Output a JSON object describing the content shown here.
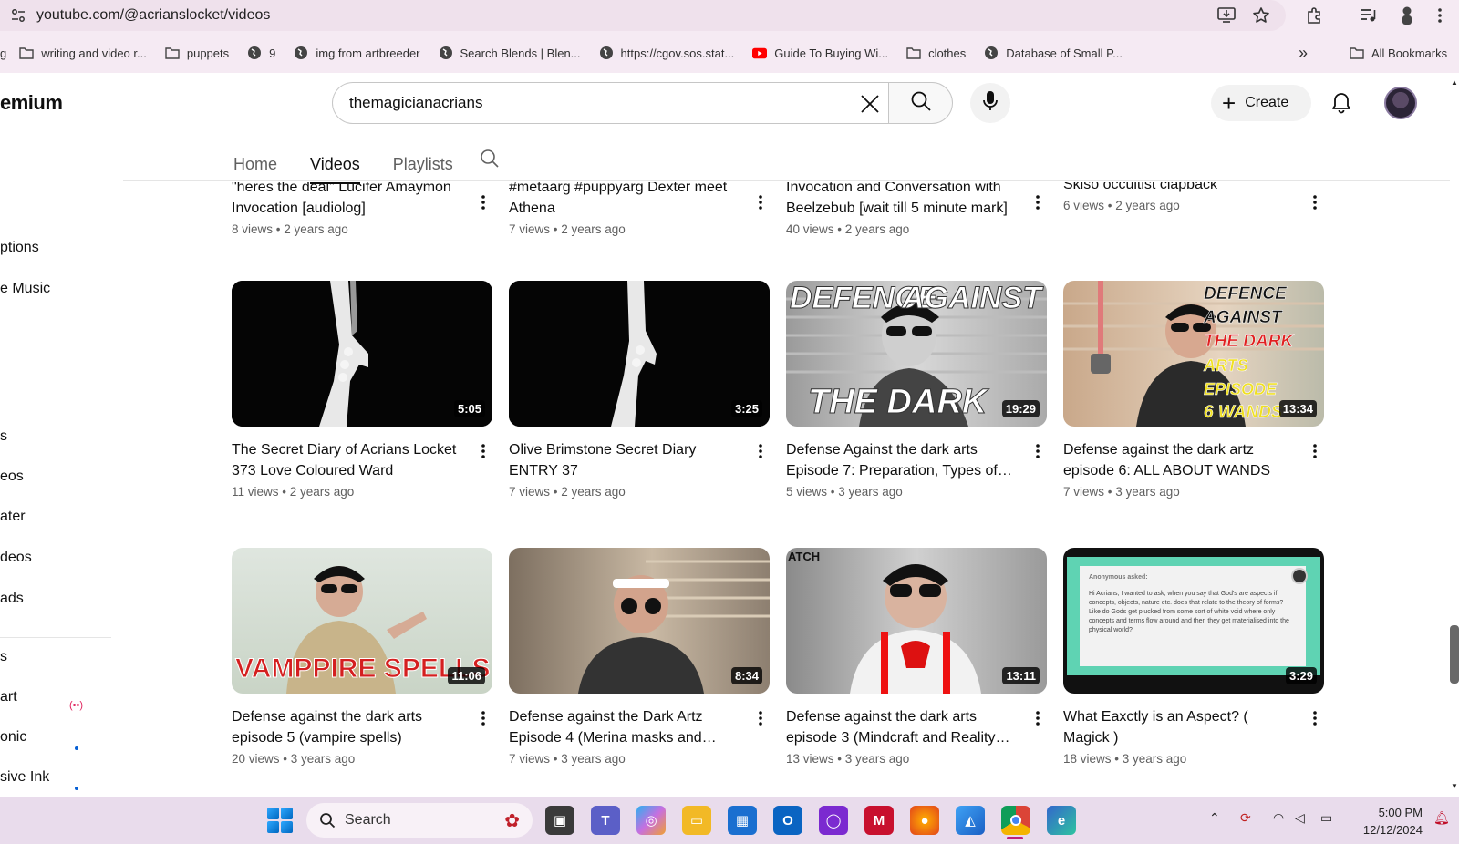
{
  "browser": {
    "url": "youtube.com/@acrianslocket/videos",
    "bookmarks": [
      "writing and video r...",
      "puppets",
      "9",
      "img from artbreeder",
      "Search Blends | Blen...",
      "https://cgov.sos.stat...",
      "Guide To Buying Wi...",
      "clothes",
      "Database of Small P..."
    ],
    "bookmark_first_partial": "g",
    "overflow_label": "»",
    "all_bookmarks": "All Bookmarks"
  },
  "header": {
    "logo_partial": "emium",
    "search_value": "themagicianacrians",
    "create_label": "Create"
  },
  "tabs": [
    "Home",
    "Videos",
    "Playlists"
  ],
  "sidebar": [
    "ptions",
    "e Music",
    "s",
    "eos",
    "ater",
    "deos",
    "ads",
    "s",
    "art",
    "onic",
    "sive Ink"
  ],
  "sidebar_live": "(••)",
  "videos": [
    {
      "title": "\"heres the deal\" Lucifer Amaymon Invocation [audiolog]",
      "views": "8 views",
      "age": "2 years ago",
      "duration": ""
    },
    {
      "title": "#metaarg #puppyarg Dexter meet Athena",
      "views": "7 views",
      "age": "2 years ago",
      "duration": ""
    },
    {
      "title": "Invocation and Conversation with Beelzebub [wait till 5 minute mark]",
      "views": "40 views",
      "age": "2 years ago",
      "duration": ""
    },
    {
      "title": "Skiso occultist clapback",
      "views": "6 views",
      "age": "2 years ago",
      "duration": ""
    },
    {
      "title": "The Secret Diary of Acrians Locket 373 Love Coloured Ward",
      "views": "11 views",
      "age": "2 years ago",
      "duration": "5:05"
    },
    {
      "title": "Olive Brimstone Secret Diary ENTRY 37",
      "views": "7 views",
      "age": "2 years ago",
      "duration": "3:25"
    },
    {
      "title": "Defense Against the dark arts Episode 7: Preparation, Types of…",
      "views": "5 views",
      "age": "3 years ago",
      "duration": "19:29"
    },
    {
      "title": "Defense against the dark artz episode 6: ALL ABOUT WANDS",
      "views": "7 views",
      "age": "3 years ago",
      "duration": "13:34"
    },
    {
      "title": "Defense against the dark arts episode 5 (vampire spells)",
      "views": "20 views",
      "age": "3 years ago",
      "duration": "11:06"
    },
    {
      "title": "Defense against the Dark Artz Episode 4 (Merina masks and…",
      "views": "7 views",
      "age": "3 years ago",
      "duration": "8:34"
    },
    {
      "title": "Defense against the dark arts episode 3 (Mindcraft and Reality…",
      "views": "13 views",
      "age": "3 years ago",
      "duration": "13:11"
    },
    {
      "title": "What Eaxctly is an Aspect? ( Magick )",
      "views": "18 views",
      "age": "3 years ago",
      "duration": "3:29"
    }
  ],
  "thumb_text": {
    "defence_against": "DEFENCE",
    "against": "AGAINST",
    "the_dark_arts": "THE DARK ARTS",
    "def2_line1": "DEFENCE",
    "def2_line2": "AGAINST",
    "def2_line3": "THE DARK",
    "def2_line4": "ARTS EPISODE",
    "def2_line5": "6 WANDS",
    "vampire": "VAMPPIRE SPELLS",
    "watch": "ATCH",
    "aspect_asked": "Anonymous asked:",
    "aspect_body": "Hi Acrians, I wanted to ask, when you say that God's are aspects if concepts, objects, nature etc. does that relate to the theory of forms? Like do Gods get plucked from some sort of white void where only concepts and terms flow around and then they get materialised into the physical world?"
  },
  "taskbar": {
    "search_label": "Search",
    "time": "5:00 PM",
    "date": "12/12/2024"
  }
}
